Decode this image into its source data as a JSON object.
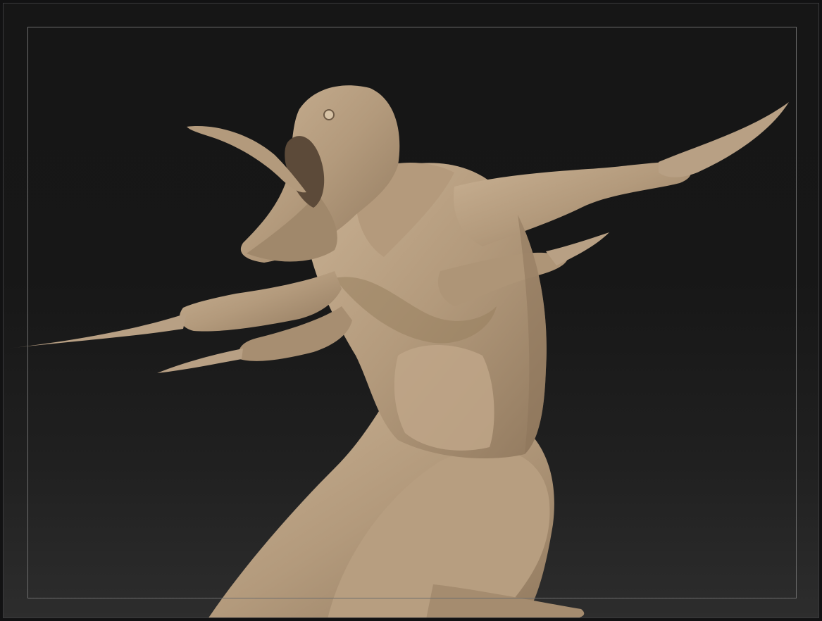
{
  "app": {
    "viewport_label": "",
    "model_name": ""
  },
  "theme": {
    "background_top": "#161616",
    "background_bottom": "#2d2d2d",
    "frame_guide_color": "#6d6d6d",
    "clay_color": "#b49a7c",
    "clay_shadow": "#8a7258",
    "clay_highlight": "#d2bc9e"
  }
}
